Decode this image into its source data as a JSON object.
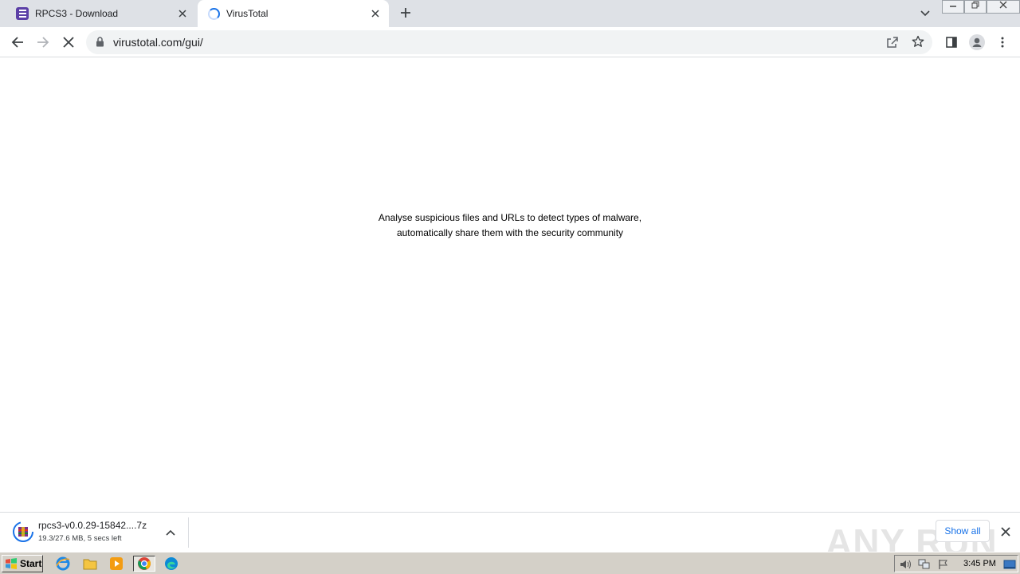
{
  "tabs": [
    {
      "title": "RPCS3 - Download",
      "active": false
    },
    {
      "title": "VirusTotal",
      "active": true
    }
  ],
  "toolbar": {
    "url": "virustotal.com/gui/"
  },
  "content": {
    "tagline_line1": "Analyse suspicious files and URLs to detect types of malware,",
    "tagline_line2": "automatically share them with the security community"
  },
  "download": {
    "filename": "rpcs3-v0.0.29-15842....7z",
    "status": "19.3/27.6 MB, 5 secs left",
    "show_all_label": "Show all"
  },
  "watermark": "ANY RUN",
  "taskbar": {
    "start_label": "Start",
    "clock": "3:45 PM"
  },
  "colors": {
    "accent": "#1a73e8",
    "tabstrip": "#dee1e6",
    "rpcs3_brand": "#5b3fa6"
  }
}
